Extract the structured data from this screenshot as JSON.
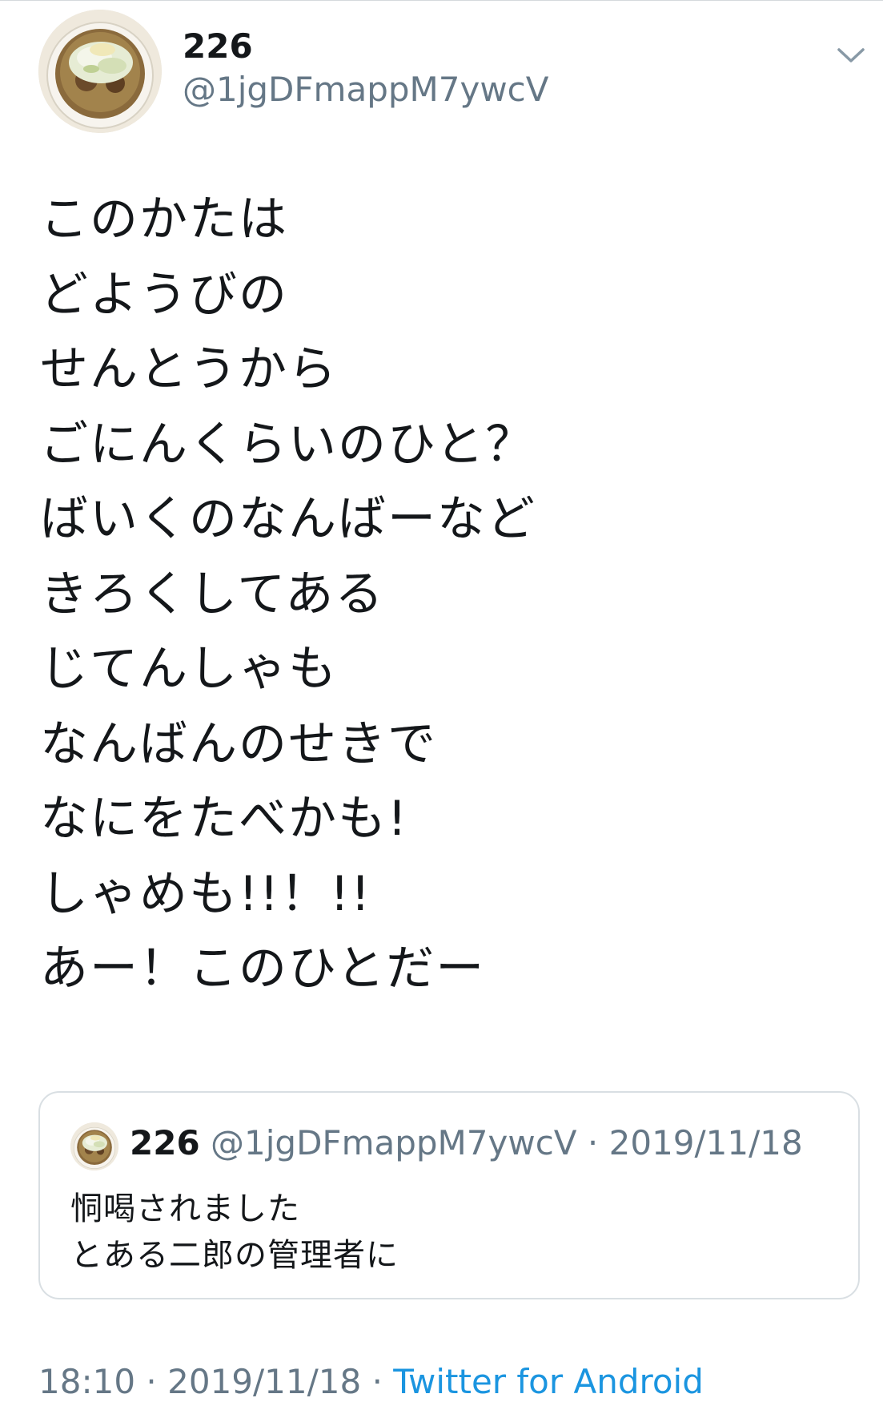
{
  "tweet": {
    "author": {
      "display_name": "226",
      "handle": "@1jgDFmappM7ywcV"
    },
    "lines": [
      "このかたは",
      "どようびの",
      "せんとうから",
      "ごにんくらいのひと？",
      "ばいくのなんばーなど",
      "きろくしてある",
      "じてんしゃも",
      "なんばんのせきで",
      "なにをたべかも!",
      "しゃめも!!！!!",
      "あー！このひとだー"
    ],
    "quoted": {
      "display_name": "226",
      "handle": "@1jgDFmappM7ywcV",
      "separator": "·",
      "date": "2019/11/18",
      "lines": [
        "恫喝されました",
        "とある二郎の管理者に"
      ]
    },
    "footer": {
      "time": "18:10",
      "separator": "·",
      "date": "2019/11/18",
      "separator2": "·",
      "source": "Twitter for Android"
    }
  },
  "icons": {
    "menu": "chevron-down-icon",
    "avatar": "ramen-bowl-photo"
  },
  "colors": {
    "text": "#14171a",
    "secondary": "#657786",
    "link": "#1b95e0",
    "border": "#d9dfe3"
  }
}
